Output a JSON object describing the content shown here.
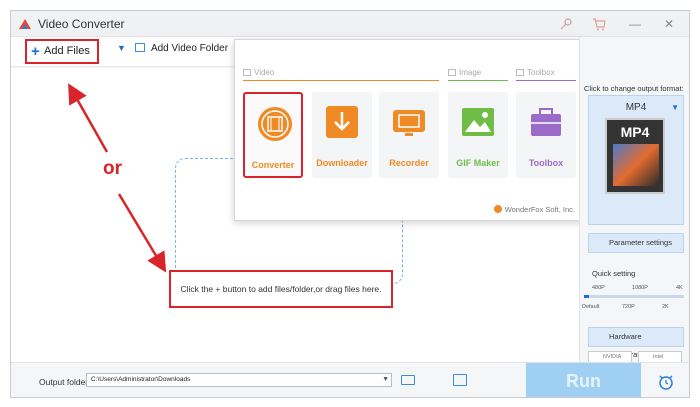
{
  "app": {
    "title": "Video Converter",
    "logo_icon": "wonderfox-logo-icon"
  },
  "titlebar": {
    "icons": [
      "key-icon",
      "cart-icon",
      "minimize-icon",
      "close-icon"
    ],
    "minimize": "—",
    "close": "✕"
  },
  "toolbar": {
    "add_files": "Add Files",
    "add_folder": "Add Video Folder"
  },
  "annotation": {
    "or_text": "or",
    "color": "#d9242b"
  },
  "drop_area": {
    "hint": "Click the + button to add files/folder,or drag files here."
  },
  "popup": {
    "sections": [
      {
        "label": "Video",
        "color": "#f08a24"
      },
      {
        "label": "Image",
        "color": "#6fbd47"
      },
      {
        "label": "Toolbox",
        "color": "#9b6bc8"
      }
    ],
    "tools": [
      {
        "label": "Converter",
        "color": "#f08a24",
        "icon": "film-reel-icon",
        "selected": true
      },
      {
        "label": "Downloader",
        "color": "#f08a24",
        "icon": "download-arrow-icon",
        "selected": false
      },
      {
        "label": "Recorder",
        "color": "#f08a24",
        "icon": "screen-record-icon",
        "selected": false
      },
      {
        "label": "GIF Maker",
        "color": "#6fbd47",
        "icon": "image-landscape-icon",
        "selected": false
      },
      {
        "label": "Toolbox",
        "color": "#9b6bc8",
        "icon": "toolbox-icon",
        "selected": false
      }
    ],
    "credit": "WonderFox Soft, Inc."
  },
  "right_panel": {
    "hint": "Click to change output format:",
    "format": "MP4",
    "format_box_text": "MP4",
    "parameter_settings": "Parameter settings",
    "quick_setting": "Quick setting",
    "ticks_top": [
      "480P",
      "1080P",
      "4K"
    ],
    "ticks_bottom": [
      "Default",
      "720P",
      "2K"
    ],
    "quality_level": 0.05,
    "hardware_acceleration": "Hardware acceleration",
    "chips": [
      "NVIDIA",
      "Intel"
    ]
  },
  "bottom": {
    "output_label": "Output folder:",
    "output_path": "C:\\Users\\Administrator\\Downloads",
    "run": "Run"
  }
}
